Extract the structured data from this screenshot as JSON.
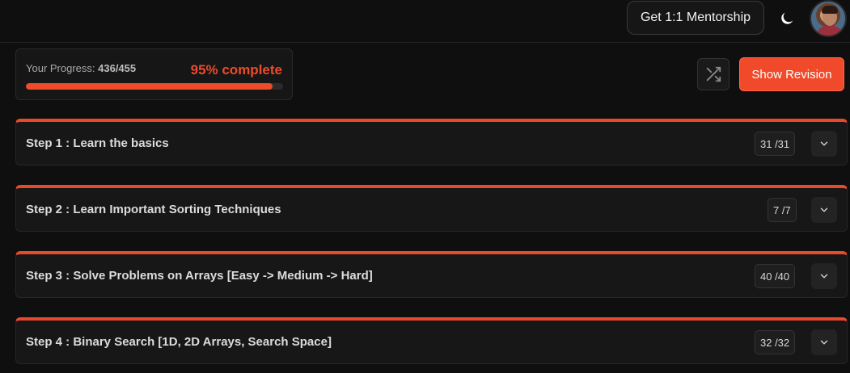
{
  "header": {
    "mentorship_label": "Get 1:1 Mentorship",
    "theme_icon": "moon-icon",
    "avatar_icon": "user-avatar"
  },
  "progress": {
    "label_prefix": "Your Progress: ",
    "count": "436/455",
    "percent_text": "95% complete",
    "completed": 436,
    "total": 455,
    "fraction": 0.958
  },
  "actions": {
    "shuffle_icon": "shuffle-icon",
    "revision_label": "Show Revision"
  },
  "colors": {
    "accent": "#ee4b2b",
    "background": "#0f0f0f",
    "card": "#171717"
  },
  "steps": [
    {
      "title": "Step 1 : Learn the basics",
      "count": "31 /31"
    },
    {
      "title": "Step 2 : Learn Important Sorting Techniques",
      "count": "7 /7"
    },
    {
      "title": "Step 3 : Solve Problems on Arrays [Easy -> Medium -> Hard]",
      "count": "40 /40"
    },
    {
      "title": "Step 4 : Binary Search [1D, 2D Arrays, Search Space]",
      "count": "32 /32"
    }
  ]
}
